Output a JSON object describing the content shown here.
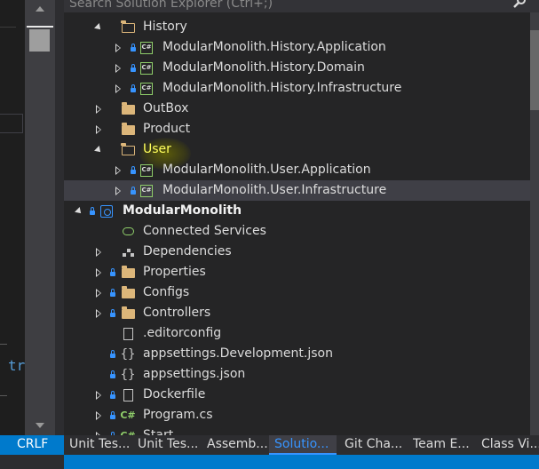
{
  "search": {
    "placeholder": "Search Solution Explorer (Ctrl+;)"
  },
  "tree": [
    {
      "label": "History",
      "icon": "folder-open-icon",
      "expanded": true
    },
    {
      "label": "ModularMonolith.History.Application",
      "icon": "csharp-project-icon"
    },
    {
      "label": "ModularMonolith.History.Domain",
      "icon": "csharp-project-icon"
    },
    {
      "label": "ModularMonolith.History.Infrastructure",
      "icon": "csharp-project-icon"
    },
    {
      "label": "OutBox",
      "icon": "folder-icon"
    },
    {
      "label": "Product",
      "icon": "folder-icon"
    },
    {
      "label": "User",
      "icon": "folder-open-icon",
      "expanded": true
    },
    {
      "label": "ModularMonolith.User.Application",
      "icon": "csharp-project-icon"
    },
    {
      "label": "ModularMonolith.User.Infrastructure",
      "icon": "csharp-project-icon",
      "selected": true
    },
    {
      "label": "ModularMonolith",
      "icon": "web-project-icon",
      "expanded": true
    },
    {
      "label": "Connected Services",
      "icon": "connected-services-icon"
    },
    {
      "label": "Dependencies",
      "icon": "dependencies-icon"
    },
    {
      "label": "Properties",
      "icon": "properties-folder-icon"
    },
    {
      "label": "Configs",
      "icon": "folder-icon"
    },
    {
      "label": "Controllers",
      "icon": "folder-icon"
    },
    {
      "label": ".editorconfig",
      "icon": "file-icon"
    },
    {
      "label": "appsettings.Development.json",
      "icon": "json-file-icon"
    },
    {
      "label": "appsettings.json",
      "icon": "json-file-icon"
    },
    {
      "label": "Dockerfile",
      "icon": "file-icon"
    },
    {
      "label": "Program.cs",
      "icon": "csharp-file-icon"
    },
    {
      "label": "Start",
      "icon": "csharp-file-icon"
    }
  ],
  "editor": {
    "code_fragment": "tr"
  },
  "status": {
    "line_ending": "CRLF"
  },
  "tabs": [
    {
      "label": "Unit Tes..."
    },
    {
      "label": "Unit Tes..."
    },
    {
      "label": "Assemb..."
    },
    {
      "label": "Solutio...",
      "active": true
    },
    {
      "label": "Git Cha..."
    },
    {
      "label": "Team E..."
    },
    {
      "label": "Class Vi..."
    }
  ],
  "colors": {
    "accent": "#007acc",
    "folder": "#dcb67a",
    "csharp": "#8fce6a",
    "highlight": "#ffff5c"
  }
}
